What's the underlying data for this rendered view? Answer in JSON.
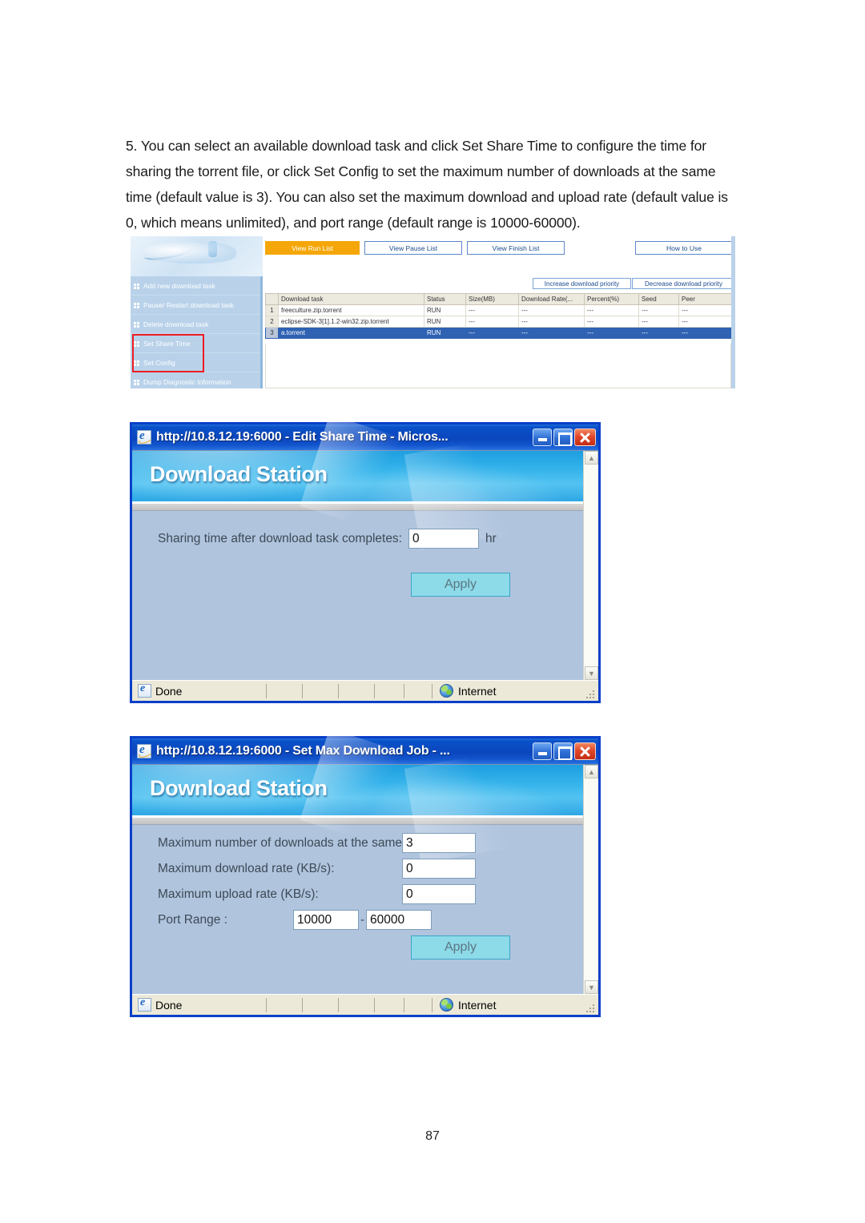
{
  "document": {
    "paragraph": "5. You can select an available download task and click Set Share Time to configure the time for sharing the torrent file, or click Set Config to set the maximum number of downloads at the same time (default value is 3).  You can also set the maximum download and upload rate (default value is 0, which means unlimited), and port range (default range is 10000-60000).",
    "page_number": "87"
  },
  "download_station_list": {
    "tabs": [
      {
        "label": "View Run List",
        "active": true
      },
      {
        "label": "View Pause List",
        "active": false
      },
      {
        "label": "View Finish List",
        "active": false
      },
      {
        "label": "How to Use",
        "active": false
      }
    ],
    "sidebar": {
      "items": [
        {
          "label": "Add new download task",
          "highlighted": false
        },
        {
          "label": "Pause/ Restart download task",
          "highlighted": false
        },
        {
          "label": "Delete download task",
          "highlighted": false
        },
        {
          "label": "Set Share Time",
          "highlighted": true
        },
        {
          "label": "Set Config",
          "highlighted": true
        },
        {
          "label": "Dump Diagnostic Information",
          "highlighted": false
        }
      ],
      "highlight_color": "#ed1c24"
    },
    "priority_buttons": [
      "Increase download priority",
      "Decrease download priority"
    ],
    "table": {
      "columns": [
        "",
        "Download task",
        "Status",
        "Size(MB)",
        "Download Rate(...",
        "Percent(%)",
        "Seed",
        "Peer"
      ],
      "rows": [
        {
          "index": "1",
          "task": "freeculture.zip.torrent",
          "status": "RUN",
          "size": "---",
          "rate": "---",
          "percent": "---",
          "seed": "---",
          "peer": "---",
          "selected": false
        },
        {
          "index": "2",
          "task": "eclipse-SDK-3[1].1.2-win32.zip.torrent",
          "status": "RUN",
          "size": "---",
          "rate": "---",
          "percent": "---",
          "seed": "---",
          "peer": "---",
          "selected": false
        },
        {
          "index": "3",
          "task": "a.torrent",
          "status": "RUN",
          "size": "---",
          "rate": "---",
          "percent": "---",
          "seed": "---",
          "peer": "---",
          "selected": true
        }
      ]
    },
    "accent_color": "#f5a709",
    "selection_color": "#2f62b3"
  },
  "share_time_dialog": {
    "title": "http://10.8.12.19:6000 - Edit Share Time - Micros...",
    "app_title": "Download Station",
    "field_label": "Sharing time after download task completes:",
    "field_value": "0",
    "field_suffix": "hr",
    "apply_label": "Apply",
    "status_text": "Done",
    "zone_text": "Internet"
  },
  "max_download_dialog": {
    "title": "http://10.8.12.19:6000 - Set Max Download Job - ...",
    "app_title": "Download Station",
    "fields": [
      {
        "label": "Maximum number of downloads at the same time:",
        "value": "3"
      },
      {
        "label": "Maximum download rate (KB/s):",
        "value": "0"
      },
      {
        "label": "Maximum upload rate (KB/s):",
        "value": "0"
      }
    ],
    "port_range": {
      "label": "Port Range :",
      "from": "10000",
      "separator": "-",
      "to": "60000"
    },
    "apply_label": "Apply",
    "status_text": "Done",
    "zone_text": "Internet"
  }
}
